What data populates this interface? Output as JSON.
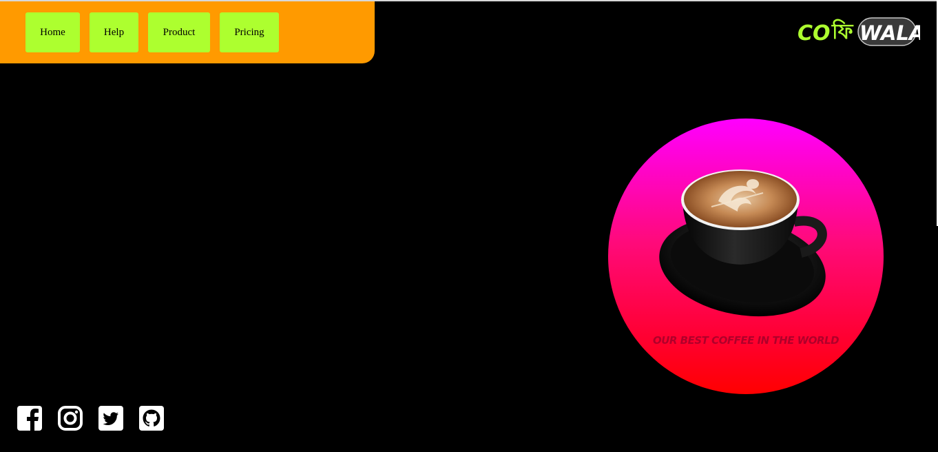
{
  "nav": {
    "items": [
      {
        "label": "Home"
      },
      {
        "label": "Help"
      },
      {
        "label": "Product"
      },
      {
        "label": "Pricing"
      }
    ]
  },
  "brand": {
    "part1": "CO",
    "part2": "ফি",
    "part3": "WALA"
  },
  "hero": {
    "tagline": "OUR BEST COFFEE IN THE WORLD",
    "image": "coffee-cup-latte-art"
  },
  "social": {
    "icons": [
      "facebook-icon",
      "instagram-icon",
      "twitter-icon",
      "github-icon"
    ]
  },
  "colors": {
    "background": "#000000",
    "navbar": "#ff9a00",
    "nav_button": "#adff2f",
    "circle_top": "#ff00ff",
    "circle_bottom": "#ff0000",
    "brand_green": "#adff2f"
  }
}
